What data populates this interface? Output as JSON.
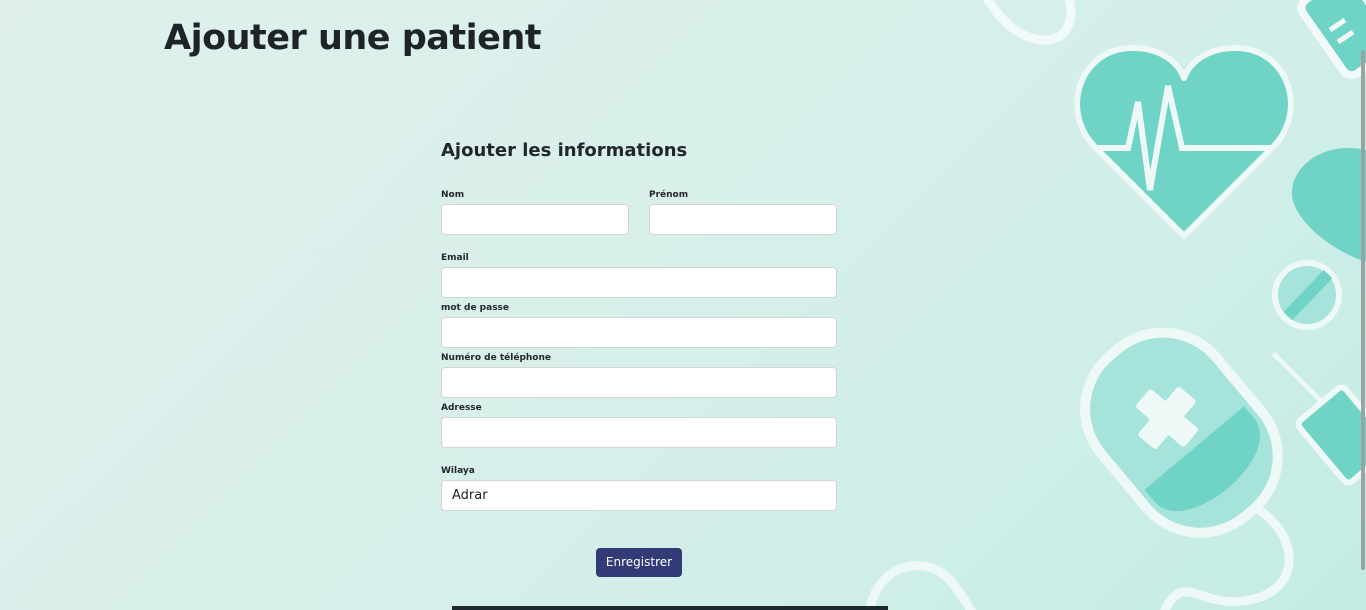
{
  "page": {
    "title": "Ajouter une patient"
  },
  "form": {
    "title": "Ajouter les informations",
    "fields": {
      "nom": {
        "label": "Nom",
        "value": ""
      },
      "prenom": {
        "label": "Prénom",
        "value": ""
      },
      "email": {
        "label": "Email",
        "value": ""
      },
      "password": {
        "label": "mot de passe",
        "value": ""
      },
      "phone": {
        "label": "Numéro de téléphone",
        "value": ""
      },
      "address": {
        "label": "Adresse",
        "value": ""
      },
      "wilaya": {
        "label": "Wilaya",
        "value": "Adrar"
      }
    },
    "submit_label": "Enregistrer"
  },
  "decor": {
    "icons": [
      "heart-pulse-icon",
      "iv-bag-icon",
      "syringe-icon",
      "pill-icon",
      "stethoscope-icon",
      "thermometer-icon"
    ],
    "accent": "#6fd3c6",
    "outline": "#eef8f6"
  },
  "theme": {
    "background": "#d8efea",
    "button": "#323a78",
    "text": "#1e2229"
  }
}
